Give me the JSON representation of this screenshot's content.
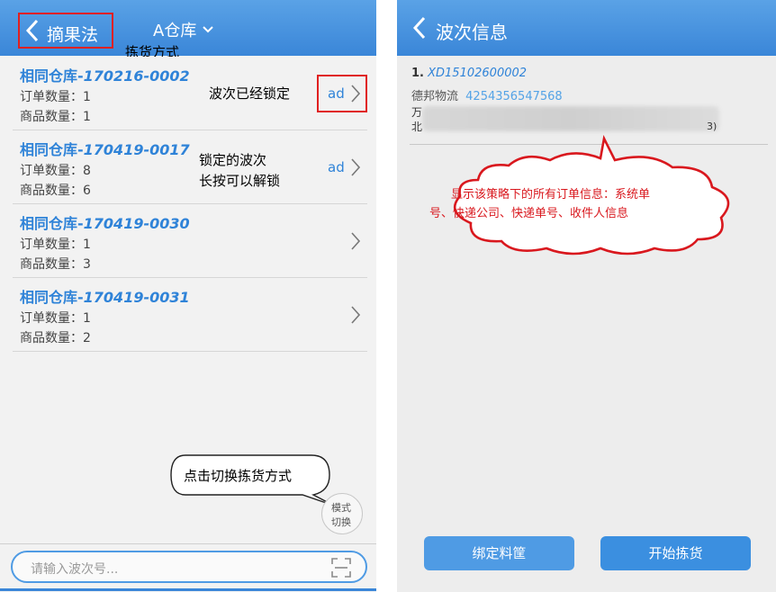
{
  "left": {
    "header": {
      "back_label": "摘果法",
      "warehouse": "A仓库",
      "dropdown_glyph": "⌄"
    },
    "annotation_pick_mode": "拣货方式",
    "waves": [
      {
        "prefix": "相同仓库-",
        "code": "170216-0002",
        "order_label": "订单数量：1",
        "goods_label": "商品数量：1",
        "badge": "ad"
      },
      {
        "prefix": "相同仓库-",
        "code": "170419-0017",
        "order_label": "订单数量：8",
        "goods_label": "商品数量：6",
        "badge": "ad"
      },
      {
        "prefix": "相同仓库-",
        "code": "170419-0030",
        "order_label": "订单数量：1",
        "goods_label": "商品数量：3",
        "badge": ""
      },
      {
        "prefix": "相同仓库-",
        "code": "170419-0031",
        "order_label": "订单数量：1",
        "goods_label": "商品数量：2",
        "badge": ""
      }
    ],
    "annotation_locked": "波次已经锁定",
    "annotation_unlock_1": "锁定的波次",
    "annotation_unlock_2": "长按可以解锁",
    "annotation_switch": "点击切换拣货方式",
    "mode_switch_line1": "模式",
    "mode_switch_line2": "切换",
    "search_placeholder": "请输入波次号..."
  },
  "right": {
    "header": {
      "title": "波次信息"
    },
    "order": {
      "index": "1.",
      "sys_no": "XD15102600002",
      "carrier": "德邦物流",
      "tracking": "4254356547568",
      "row3_visible": "万",
      "row4_visible": "北",
      "row4_tail": "3)"
    },
    "callout_line1": "显示该策略下的所有订单信息：系统单",
    "callout_line2": "号、快递公司、快递单号、收件人信息",
    "buttons": {
      "bind": "绑定料筐",
      "start": "开始拣货"
    }
  },
  "colors": {
    "header_blue": "#3a86d8",
    "link_blue": "#2f83d8",
    "annotation_red": "#e02020",
    "callout_text_red": "#d9181e"
  }
}
